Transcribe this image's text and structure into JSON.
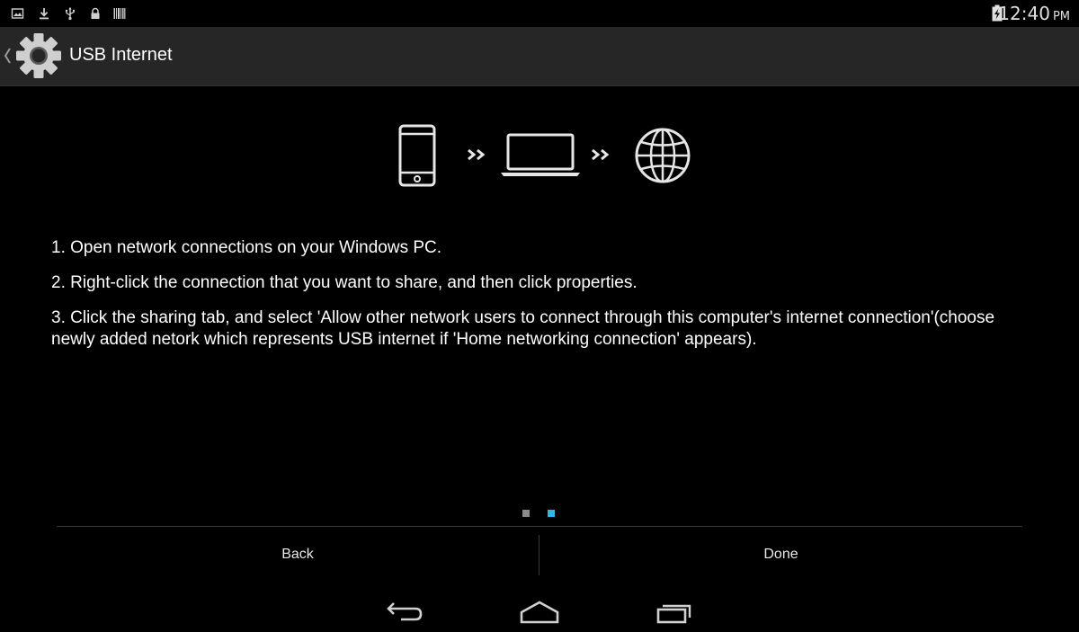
{
  "status_bar": {
    "time": "12:40",
    "ampm": "PM",
    "icons": [
      "image-notification-icon",
      "download-icon",
      "usb-icon",
      "lock-icon",
      "barcode-icon",
      "battery-charging-icon"
    ]
  },
  "action_bar": {
    "title": "USB Internet",
    "app_icon": "settings-gear-icon"
  },
  "illustration": {
    "icons": [
      "phone-icon",
      "double-chevron-icon",
      "laptop-icon",
      "double-chevron-icon",
      "globe-icon"
    ]
  },
  "instructions": {
    "steps": [
      "1. Open network connections on your Windows PC.",
      "2. Right-click the connection that you want to share, and then click properties.",
      "3. Click the sharing tab, and select 'Allow other network users to connect through this computer's internet connection'(choose newly added netork which represents USB internet if 'Home networking connection' appears)."
    ]
  },
  "page_indicator": {
    "total": 2,
    "current": 2,
    "active_color": "#33b5e5",
    "inactive_color": "#8a8a8a"
  },
  "buttons": {
    "back_label": "Back",
    "done_label": "Done"
  },
  "nav_bar": {
    "icons": [
      "nav-back-icon",
      "nav-home-icon",
      "nav-recents-icon"
    ]
  }
}
